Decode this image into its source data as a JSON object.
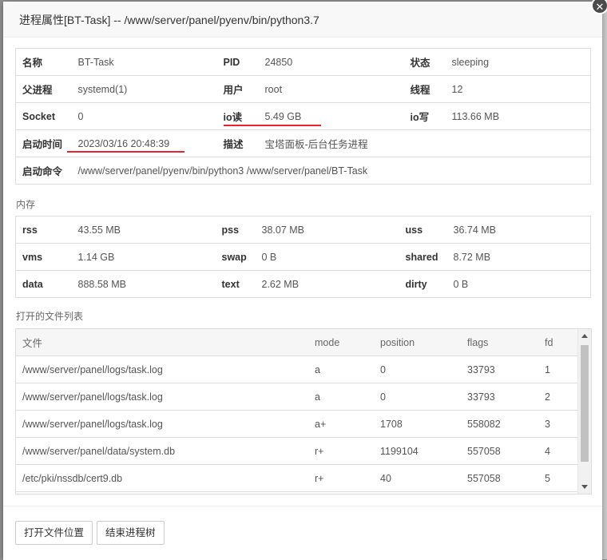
{
  "dialog": {
    "title": "进程属性[BT-Task] -- /www/server/panel/pyenv/bin/python3.7",
    "close_glyph": "✕"
  },
  "process": {
    "rows": [
      [
        [
          "名称",
          "BT-Task"
        ],
        [
          "PID",
          "24850"
        ],
        [
          "状态",
          "sleeping"
        ]
      ],
      [
        [
          "父进程",
          "systemd(1)"
        ],
        [
          "用户",
          "root"
        ],
        [
          "线程",
          "12"
        ]
      ],
      [
        [
          "Socket",
          "0"
        ],
        [
          "io读",
          "5.49 GB"
        ],
        [
          "io写",
          "113.66 MB"
        ]
      ],
      [
        [
          "启动时间",
          "2023/03/16 20:48:39"
        ],
        [
          "描述",
          "宝塔面板-后台任务进程"
        ]
      ]
    ],
    "command_label": "启动命令",
    "command_value": "/www/server/panel/pyenv/bin/python3 /www/server/panel/BT-Task"
  },
  "memory": {
    "section_title": "内存",
    "rows": [
      [
        [
          "rss",
          "43.55 MB"
        ],
        [
          "pss",
          "38.07 MB"
        ],
        [
          "uss",
          "36.74 MB"
        ]
      ],
      [
        [
          "vms",
          "1.14 GB"
        ],
        [
          "swap",
          "0 B"
        ],
        [
          "shared",
          "8.72 MB"
        ]
      ],
      [
        [
          "data",
          "888.58 MB"
        ],
        [
          "text",
          "2.62 MB"
        ],
        [
          "dirty",
          "0 B"
        ]
      ]
    ]
  },
  "files": {
    "section_title": "打开的文件列表",
    "columns": [
      "文件",
      "mode",
      "position",
      "flags",
      "fd"
    ],
    "rows": [
      [
        "/www/server/panel/logs/task.log",
        "a",
        "0",
        "33793",
        "1"
      ],
      [
        "/www/server/panel/logs/task.log",
        "a",
        "0",
        "33793",
        "2"
      ],
      [
        "/www/server/panel/logs/task.log",
        "a+",
        "1708",
        "558082",
        "3"
      ],
      [
        "/www/server/panel/data/system.db",
        "r+",
        "1199104",
        "557058",
        "4"
      ],
      [
        "/etc/pki/nssdb/cert9.db",
        "r+",
        "40",
        "557058",
        "5"
      ]
    ]
  },
  "footer": {
    "open_location_label": "打开文件位置",
    "kill_tree_label": "结束进程树"
  },
  "annotation_color": "#e8242c"
}
